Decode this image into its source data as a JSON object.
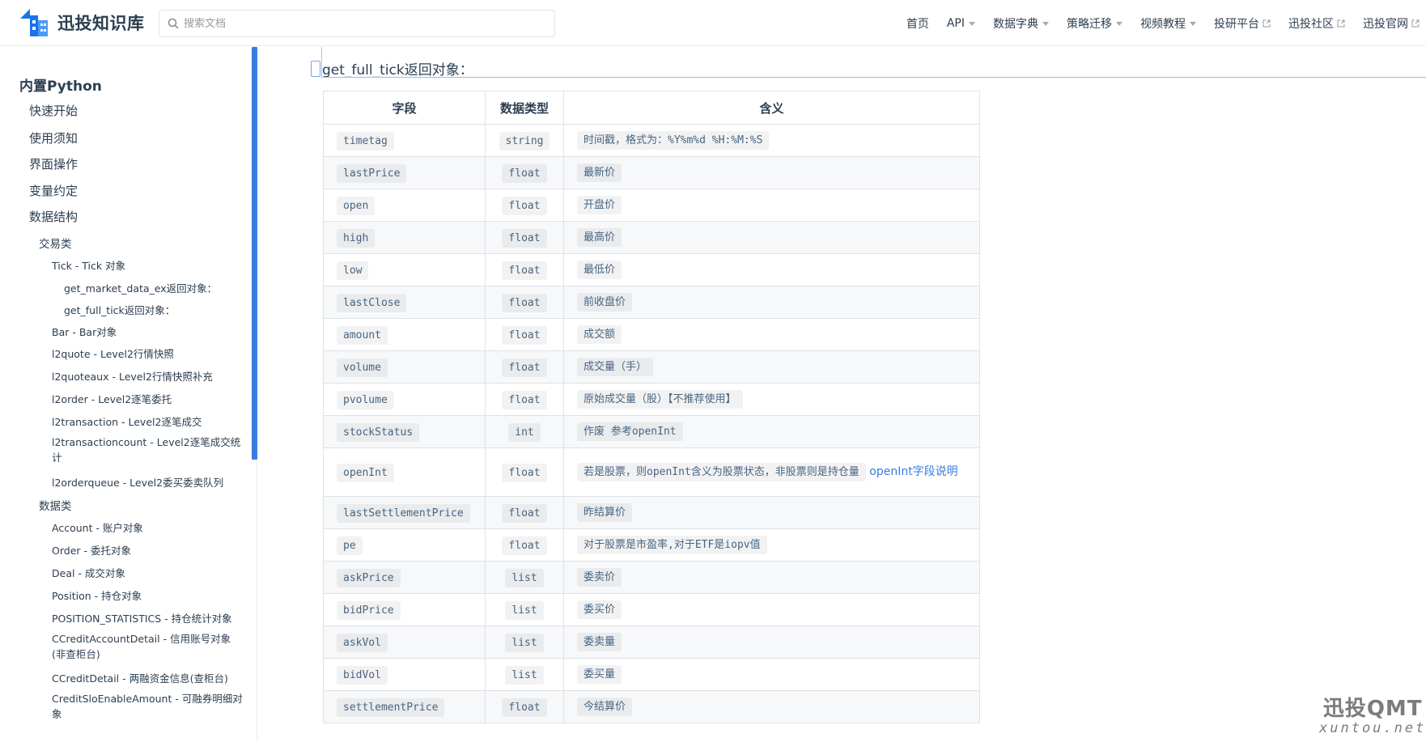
{
  "navbar": {
    "brand": "迅投知识库",
    "search_placeholder": "搜索文档",
    "links": [
      {
        "label": "首页",
        "type": "plain"
      },
      {
        "label": "API",
        "type": "dropdown"
      },
      {
        "label": "数据字典",
        "type": "dropdown"
      },
      {
        "label": "策略迁移",
        "type": "dropdown"
      },
      {
        "label": "视频教程",
        "type": "dropdown"
      },
      {
        "label": "投研平台",
        "type": "external"
      },
      {
        "label": "迅投社区",
        "type": "external"
      },
      {
        "label": "迅投官网",
        "type": "external"
      }
    ]
  },
  "sidebar": {
    "items": [
      {
        "label": "内置Python",
        "level": 0
      },
      {
        "label": "快速开始",
        "level": 1
      },
      {
        "label": "使用须知",
        "level": 1
      },
      {
        "label": "界面操作",
        "level": 1
      },
      {
        "label": "变量约定",
        "level": 1
      },
      {
        "label": "数据结构",
        "level": 1
      },
      {
        "label": "交易类",
        "level": 2
      },
      {
        "label": "Tick - Tick 对象",
        "level": 3
      },
      {
        "label": "get_market_data_ex返回对象：",
        "level": 4
      },
      {
        "label": "get_full_tick返回对象：",
        "level": 4
      },
      {
        "label": "Bar - Bar对象",
        "level": 3
      },
      {
        "label": "l2quote - Level2行情快照",
        "level": 3
      },
      {
        "label": "l2quoteaux - Level2行情快照补充",
        "level": 3
      },
      {
        "label": "l2order - Level2逐笔委托",
        "level": 3
      },
      {
        "label": "l2transaction - Level2逐笔成交",
        "level": 3
      },
      {
        "label": "l2transactioncount - Level2逐笔成交统计",
        "level": 3
      },
      {
        "label": "l2orderqueue - Level2委买委卖队列",
        "level": 3
      },
      {
        "label": "数据类",
        "level": 2
      },
      {
        "label": "Account - 账户对象",
        "level": 3
      },
      {
        "label": "Order - 委托对象",
        "level": 3
      },
      {
        "label": "Deal - 成交对象",
        "level": 3
      },
      {
        "label": "Position - 持仓对象",
        "level": 3
      },
      {
        "label": "POSITION_STATISTICS - 持仓统计对象",
        "level": 3
      },
      {
        "label": "CCreditAccountDetail - 信用账号对象(非查柜台)",
        "level": 3
      },
      {
        "label": "CCreditDetail - 两融资金信息(查柜台)",
        "level": 3
      },
      {
        "label": "CreditSloEnableAmount - 可融券明细对象",
        "level": 3
      }
    ]
  },
  "main": {
    "section_title": "get_full_tick返回对象：",
    "table": {
      "headers": [
        "字段",
        "数据类型",
        "含义"
      ],
      "rows": [
        {
          "field": "timetag",
          "type": "string",
          "desc": "时间戳，格式为：%Y%m%d %H:%M:%S"
        },
        {
          "field": "lastPrice",
          "type": "float",
          "desc": "最新价"
        },
        {
          "field": "open",
          "type": "float",
          "desc": "开盘价"
        },
        {
          "field": "high",
          "type": "float",
          "desc": "最高价"
        },
        {
          "field": "low",
          "type": "float",
          "desc": "最低价"
        },
        {
          "field": "lastClose",
          "type": "float",
          "desc": "前收盘价"
        },
        {
          "field": "amount",
          "type": "float",
          "desc": "成交额"
        },
        {
          "field": "volume",
          "type": "float",
          "desc": "成交量（手）"
        },
        {
          "field": "pvolume",
          "type": "float",
          "desc": "原始成交量（股）【不推荐使用】"
        },
        {
          "field": "stockStatus",
          "type": "int",
          "desc": "作废 参考openInt"
        },
        {
          "field": "openInt",
          "type": "float",
          "desc": "若是股票，则openInt含义为股票状态，非股票则是持仓量",
          "link": "openInt字段说明"
        },
        {
          "field": "lastSettlementPrice",
          "type": "float",
          "desc": "昨结算价"
        },
        {
          "field": "pe",
          "type": "float",
          "desc": "对于股票是市盈率,对于ETF是iopv值"
        },
        {
          "field": "askPrice",
          "type": "list",
          "desc": "委卖价"
        },
        {
          "field": "bidPrice",
          "type": "list",
          "desc": "委买价"
        },
        {
          "field": "askVol",
          "type": "list",
          "desc": "委卖量"
        },
        {
          "field": "bidVol",
          "type": "list",
          "desc": "委买量"
        },
        {
          "field": "settlementPrice",
          "type": "float",
          "desc": "今结算价"
        }
      ]
    }
  },
  "watermark": {
    "main": "迅投QMT",
    "sub": "xuntou.net"
  },
  "colors": {
    "accent": "#3a7be0",
    "text": "#2c3e50",
    "code": "#476582",
    "border": "#dfe2e5"
  }
}
